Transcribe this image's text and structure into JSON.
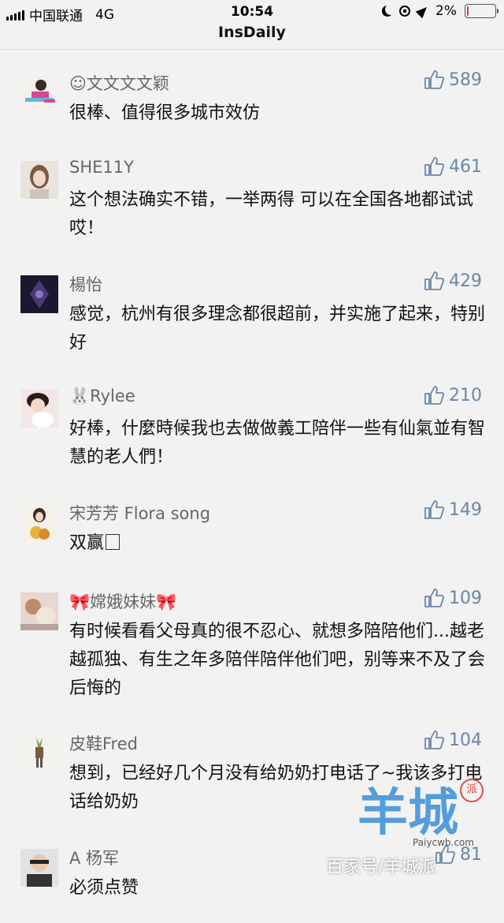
{
  "status_bar": {
    "carrier": "中国联通",
    "network": "4G",
    "time": "10:54",
    "battery": "2%",
    "battery_level": 0.02,
    "battery_color": "#e33333"
  },
  "nav": {
    "title": "InsDaily"
  },
  "comments": [
    {
      "name": "☺文文文文颖",
      "likes": "589",
      "text": "很棒、值得很多城市效仿"
    },
    {
      "name": "SHE11Y",
      "likes": "461",
      "text": "这个想法确实不错，一举两得 可以在全国各地都试试哎！"
    },
    {
      "name": "楊怡",
      "likes": "429",
      "text": "感觉，杭州有很多理念都很超前，并实施了起来，特别好"
    },
    {
      "name": "🐰Rylee",
      "likes": "210",
      "text": "好棒，什麼時候我也去做做義工陪伴一些有仙氣並有智慧的老人們！"
    },
    {
      "name": "宋芳芳 Flora song",
      "likes": "149",
      "text": "双赢"
    },
    {
      "name": "🎀嫦娥妹妹🎀",
      "likes": "109",
      "text": "有时候看看父母真的很不忍心、就想多陪陪他们...越老越孤独、有生之年多陪伴陪伴他们吧，别等来不及了会后悔的"
    },
    {
      "name": "皮鞋Fred",
      "likes": "104",
      "text": "想到，已经好几个月没有给奶奶打电话了~我该多打电话给奶奶"
    },
    {
      "name": "A 杨军",
      "likes": "81",
      "text": "必须点赞"
    }
  ],
  "watermark": {
    "brand": "羊城",
    "badge": "派",
    "url": "Paiycwb.com",
    "caption": "百家号/羊城派"
  },
  "colors": {
    "like": "#6b86a6",
    "name": "#666666",
    "background": "#f2f2f2"
  },
  "icons": [
    "signal-icon",
    "moon-icon",
    "rotation-lock-icon",
    "location-icon",
    "battery-icon",
    "thumbs-up-icon"
  ]
}
